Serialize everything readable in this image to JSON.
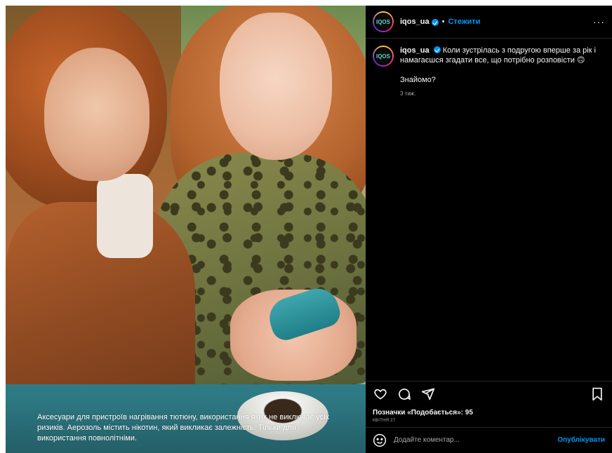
{
  "post": {
    "disclaimer": "Аксесуари для пристроїв нагрівання тютюну, використання яких не виключає усіх ризиків. Аерозоль містить нікотин, який викликає залежність. Тільки для використання повнолітніми."
  },
  "header": {
    "username": "iqos_ua",
    "separator": "•",
    "follow_label": "Стежити",
    "more_label": "···",
    "avatar_text": "IQOS"
  },
  "caption": {
    "username": "iqos_ua",
    "text": "Коли зустрілась з подругою вперше за рік і намагаєшся згадати все, що потрібно розповісти 🙃",
    "second_line": "Знайомо?",
    "time_ago": "3 тиж."
  },
  "likes": {
    "text": "Позначки «Подобається»: 95",
    "date": "КВІТНЯ 27"
  },
  "comment": {
    "placeholder": "Додайте коментар...",
    "post_label": "Опублікувати"
  },
  "icons": {
    "like": "heart-icon",
    "comment": "comment-icon",
    "share": "share-icon",
    "save": "bookmark-icon",
    "emoji": "emoji-icon",
    "verified": "verified-badge-icon"
  },
  "colors": {
    "background": "#000000",
    "accent": "#0095f6",
    "muted": "#a8a8a8"
  }
}
